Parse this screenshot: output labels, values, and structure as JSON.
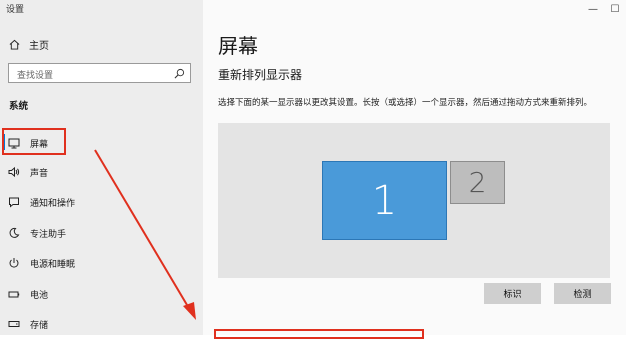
{
  "window": {
    "title": "设置",
    "minimize": "—",
    "maximize": "☐"
  },
  "sidebar": {
    "home_label": "主页",
    "search_placeholder": "查找设置",
    "section_label": "系统",
    "items": [
      {
        "icon": "monitor-icon",
        "label": "屏幕",
        "selected": true
      },
      {
        "icon": "speaker-icon",
        "label": "声音"
      },
      {
        "icon": "notification-icon",
        "label": "通知和操作"
      },
      {
        "icon": "moon-icon",
        "label": "专注助手"
      },
      {
        "icon": "power-icon",
        "label": "电源和睡眠"
      },
      {
        "icon": "battery-icon",
        "label": "电池"
      },
      {
        "icon": "storage-icon",
        "label": "存储"
      }
    ]
  },
  "main": {
    "title": "屏幕",
    "subtitle": "重新排列显示器",
    "description": "选择下面的某一显示器以更改其设置。长按（或选择）一个显示器，然后通过拖动方式来重新排列。",
    "displays": [
      {
        "number": "1",
        "selected": true
      },
      {
        "number": "2"
      }
    ],
    "identify_button": "标识",
    "detect_button": "检测"
  },
  "colors": {
    "annotation": "#e0301e",
    "selected_display": "#4a9ad9",
    "accent": "#0078d7"
  }
}
